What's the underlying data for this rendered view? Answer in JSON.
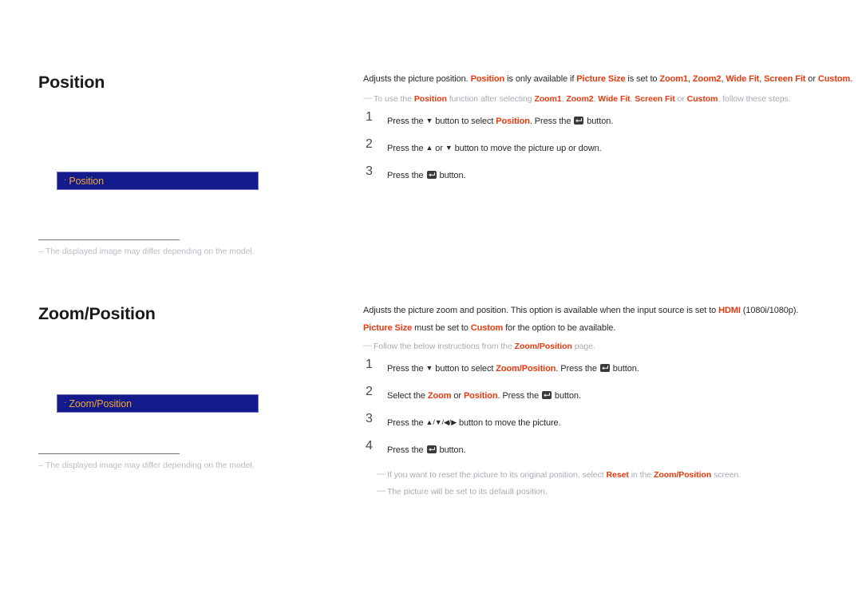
{
  "page": {
    "title": "Position / Zoom-Position settings manual page"
  },
  "sections": [
    {
      "id": "position",
      "heading": "Position",
      "menu_box": {
        "bullet": "·",
        "label": "Position"
      },
      "footnote": {
        "dash": "–",
        "text": "The displayed image may differ depending on the model."
      },
      "intro": {
        "seg1": "Adjusts the picture position. ",
        "hl1": "Position",
        "seg2": " is only available if ",
        "hl2": "Picture Size",
        "seg3": " is set to ",
        "hl3": "Zoom1",
        "seg4": ", ",
        "hl4": "Zoom2",
        "seg5": ", ",
        "hl5": "Wide Fit",
        "seg6": ", ",
        "hl6": "Screen Fit",
        "seg7": " or ",
        "hl7": "Custom",
        "seg8": "."
      },
      "note": {
        "emdash": "—",
        "seg1": "To use the ",
        "hl1": "Position",
        "seg2": " function after selecting ",
        "hl2": "Zoom1",
        "seg3": ", ",
        "hl3": "Zoom2",
        "seg4": ", ",
        "hl4": "Wide Fit",
        "seg5": ", ",
        "hl5": "Screen Fit",
        "seg6": " or ",
        "hl6": "Custom",
        "seg7": ", follow these steps."
      },
      "steps": [
        {
          "num": "1",
          "seg1": "Press the ",
          "arrow1": "▼",
          "seg2": " button to select ",
          "hl1": "Position",
          "seg3": ". Press the ",
          "icon": "enter-key-icon",
          "seg4": " button."
        },
        {
          "num": "2",
          "seg1": "Press the ",
          "arrow1": "▲",
          "seg2": " or ",
          "arrow2": "▼",
          "seg3": " button to move the picture up or down."
        },
        {
          "num": "3",
          "seg1": "Press the ",
          "icon": "enter-key-icon",
          "seg2": " button."
        }
      ]
    },
    {
      "id": "zoom-position",
      "heading": "Zoom/Position",
      "menu_box": {
        "bullet": "·",
        "label": "Zoom/Position"
      },
      "footnote": {
        "dash": "–",
        "text": "The displayed image may differ depending on the model."
      },
      "intro_line1": {
        "seg1": "Adjusts the picture zoom and position. This option is available when the input source is set to ",
        "hl1": "HDMI",
        "seg2": " (1080i/1080p)."
      },
      "intro_line2": {
        "hl1": "Picture Size",
        "seg1": " must be set to ",
        "hl2": "Custom",
        "seg2": " for the option to be available."
      },
      "note": {
        "emdash": "—",
        "seg1": "Follow the below instructions from the ",
        "hl1": "Zoom/Position",
        "seg2": " page."
      },
      "steps": [
        {
          "num": "1",
          "seg1": "Press the ",
          "arrow1": "▼",
          "seg2": " button to select ",
          "hl1": "Zoom/Position",
          "seg3": ". Press the ",
          "icon": "enter-key-icon",
          "seg4": " button."
        },
        {
          "num": "2",
          "seg1": "Select the ",
          "hl1": "Zoom",
          "seg2": " or ",
          "hl2": "Position",
          "seg3": ". Press the ",
          "icon": "enter-key-icon",
          "seg4": " button."
        },
        {
          "num": "3",
          "seg1": "Press the ",
          "arrow1": "▲",
          "sep1": "/",
          "arrow2": "▼",
          "sep2": "/",
          "arrow3": "◀",
          "sep3": "/",
          "arrow4": "▶",
          "seg2": " button to move the picture."
        },
        {
          "num": "4",
          "seg1": "Press the ",
          "icon": "enter-key-icon",
          "seg2": " button."
        }
      ],
      "end_notes": [
        {
          "emdash": "—",
          "seg1": "If you want to reset the picture to its original position, select ",
          "hl1": "Reset",
          "seg2": " in the ",
          "hl2": "Zoom/Position",
          "seg3": " screen."
        },
        {
          "emdash": "—",
          "seg1": "The picture will be set to its default position."
        }
      ]
    }
  ],
  "colors": {
    "accent_red": "#E8380D",
    "menu_bg": "#131A8C",
    "menu_border": "#6B6FC4",
    "menu_text": "#F0A72C",
    "note_gray": "#A8ABB4",
    "body_text": "#2B2B2B"
  }
}
